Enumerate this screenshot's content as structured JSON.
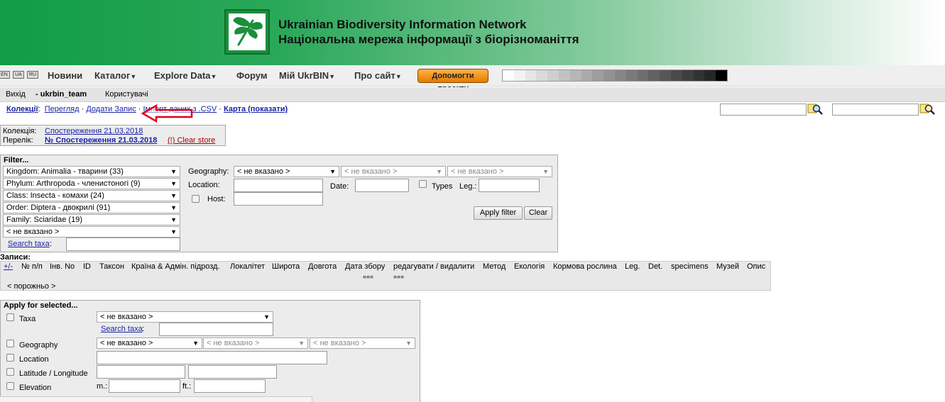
{
  "banner": {
    "title_en": "Ukrainian Biodiversity Information Network",
    "title_ua": "Національна мережа інформації з біорізноманіття",
    "logo_icon": "dragonfly-icon"
  },
  "lang": [
    "EN",
    "UA",
    "RU"
  ],
  "menu": {
    "news": "Новини",
    "catalog": "Каталог",
    "explore": "Explore Data",
    "forum": "Форум",
    "my": "Мій UkrBIN",
    "about": "Про сайт",
    "donate": "Допомогти проекту"
  },
  "userbar": {
    "logout": "Вихід",
    "user": "- ukrbin_team",
    "users": "Користувачі"
  },
  "crumbs": {
    "collections": "Колекції",
    "sep": ":",
    "view": "Перегляд",
    "add": "Додати Запис",
    "import": "Імпорт даних з .CSV",
    "map": "Карта (показати)"
  },
  "store": {
    "collection_label": "Колекція:",
    "collection_value": "Спостереження 21.03.2018",
    "list_label": "Перелік:",
    "list_value": "№ Спостереження 21.03.2018",
    "clear": "(!) Clear store"
  },
  "filter": {
    "title": "Filter...",
    "kingdom": "Kingdom: Animalia - тварини (33)",
    "phylum": "Phylum: Arthropoda - членистоногі (9)",
    "class": "Class: Insecta - комахи (24)",
    "order": "Order: Diptera - двокрилі (91)",
    "family": "Family: Sciaridae (19)",
    "none": "< не вказано >",
    "search_taxa": "Search taxa",
    "geography": "Geography:",
    "location": "Location:",
    "date": "Date:",
    "types": "Types",
    "leg": "Leg.:",
    "host": "Host:",
    "apply": "Apply filter",
    "clear": "Clear"
  },
  "records": {
    "title": "Записи:",
    "toggle": "+/-",
    "columns": [
      "№ п/п",
      "Інв. No",
      "ID",
      "Таксон",
      "Країна & Адмін. підрозд.",
      "Локалітет",
      "Широта",
      "Довгота",
      "Дата збору",
      "редагувати / видалити",
      "Метод",
      "Екологія",
      "Кормова рослина",
      "Leg.",
      "Det.",
      "specimens",
      "Музей",
      "Опис"
    ],
    "prev": "«««",
    "next": "»»»",
    "empty": "< порожньо >"
  },
  "apply": {
    "title": "Apply for selected...",
    "taxa": "Taxa",
    "geography": "Geography",
    "location": "Location",
    "latlon": "Latitude / Longitude",
    "elevation": "Elevation",
    "m": "m.:",
    "ft": "ft.:",
    "none": "< не вказано >",
    "search_taxa": "Search taxa"
  },
  "colors": {
    "link": "#1a23a6",
    "banner_green": "#119c45",
    "arrow_red": "#e3001b"
  }
}
